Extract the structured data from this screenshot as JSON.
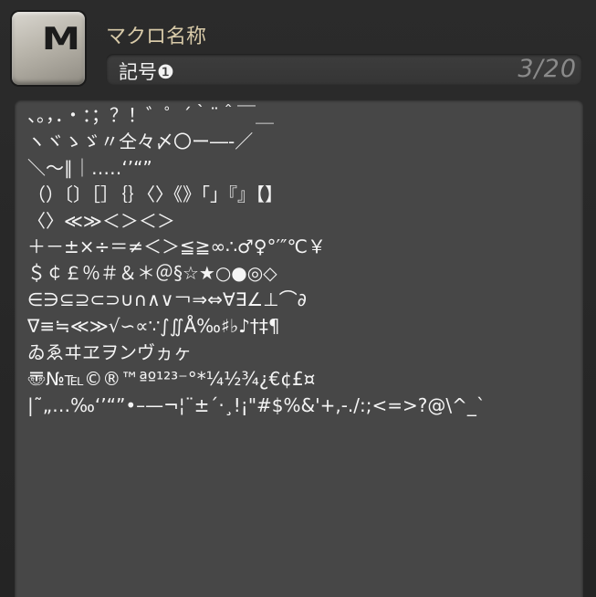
{
  "header": {
    "icon_letter": "M",
    "name_label": "マクロ名称",
    "title_value": "記号❶",
    "page_counter": "3/20"
  },
  "macro": {
    "lines": [
      "、。，．・：；？！゛゜´｀¨＾￣＿",
      "ヽヾゝゞ〃仝々〆〇ー―‐／",
      "＼～∥｜…‥‘’“”",
      "（）〔〕［］｛｝〈〉《》「」『』【】",
      "〈〉≪≫＜＞＜＞",
      "＋－±×÷＝≠＜＞≦≧∞∴♂♀°′″℃￥",
      "＄￠￡％＃＆＊＠§☆★○●◎◇",
      "∈∋⊆⊇⊂⊃∪∩∧∨￢⇒⇔∀∃∠⊥⌒∂",
      "∇≡≒≪≫√∽∝∵∫∬Å‰♯♭♪†‡¶",
      "ゐゑヰヱヲンヴヵヶ",
      "〠№℡©®™ªº¹²³⁻°*¼½¾¿€¢£¤",
      "|˜„…‰‘’“”•–—¬¦¨±´·¸!¡\"#$%&'+,-./:;<=>?@\\^_`"
    ]
  }
}
